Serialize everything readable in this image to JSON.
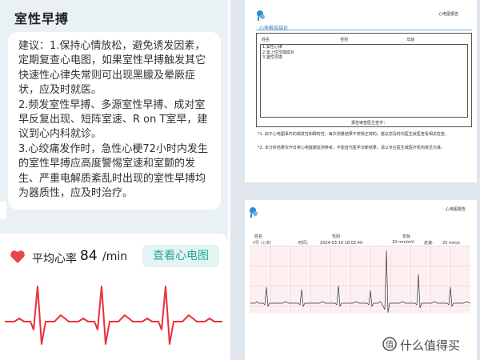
{
  "advice": {
    "title": "室性早搏",
    "paragraphs": [
      "建议：1.保持心情放松，避免诱发因素，定期复查心电图，如果室性早搏触发其它快速性心律失常则可出现黑朦及晕厥症状，应及时就医。",
      "2.频发室性早搏、多源室性早搏、成对室早反复出现、短阵室速、R on T室早，建议到心内科就诊。",
      "3.心绞痛发作时，急性心梗72小时内发生的室性早搏应高度警惕室速和室颤的发生、严重电解质紊乱时出现的室性早搏均为器质性，应及时治疗。"
    ]
  },
  "heart_rate": {
    "label": "平均心率",
    "value": "84",
    "unit": "/min",
    "button_label": "查看心电图",
    "heart_color": "#e8474a",
    "wave_color": "#e8303a"
  },
  "report_page": {
    "header_right": "心电图报告",
    "heading": "心电报告结论",
    "fields": {
      "name": "姓名",
      "gender": "性别",
      "age": "年龄"
    },
    "conclusions": [
      "1.窦性心律",
      "2.室上性早搏成对",
      "3.室性早搏"
    ],
    "doctor_sign": "报告审查医生签字：",
    "footnotes": [
      "*1. 由于心电图事件的偶发性和瞬时性，每次测量结果不排除正常的。建议您及时向医生就医查看相关检查。",
      "*2. 本分析结果仅作日常心电健康监测参考，不能替代医学诊断结果，请以专业医生或医疗机构意见为准。"
    ]
  },
  "ecg_page": {
    "header_right": "心电图报告",
    "name_label": "姓名",
    "gender_label": "性别",
    "age_label": "年龄",
    "time_label": "时间：",
    "time_value": "2024-03-10 18:02:40",
    "gain": "10 mm/mV",
    "speed_label": "走速：",
    "speed_value": "25 mm/s",
    "lead_label": "II导 (心率)"
  },
  "watermark": {
    "text": "什么值得买"
  },
  "colors": {
    "accent": "#27a79b",
    "report_blue": "#2a6fb4",
    "grid_red": "#f2b8c0"
  }
}
